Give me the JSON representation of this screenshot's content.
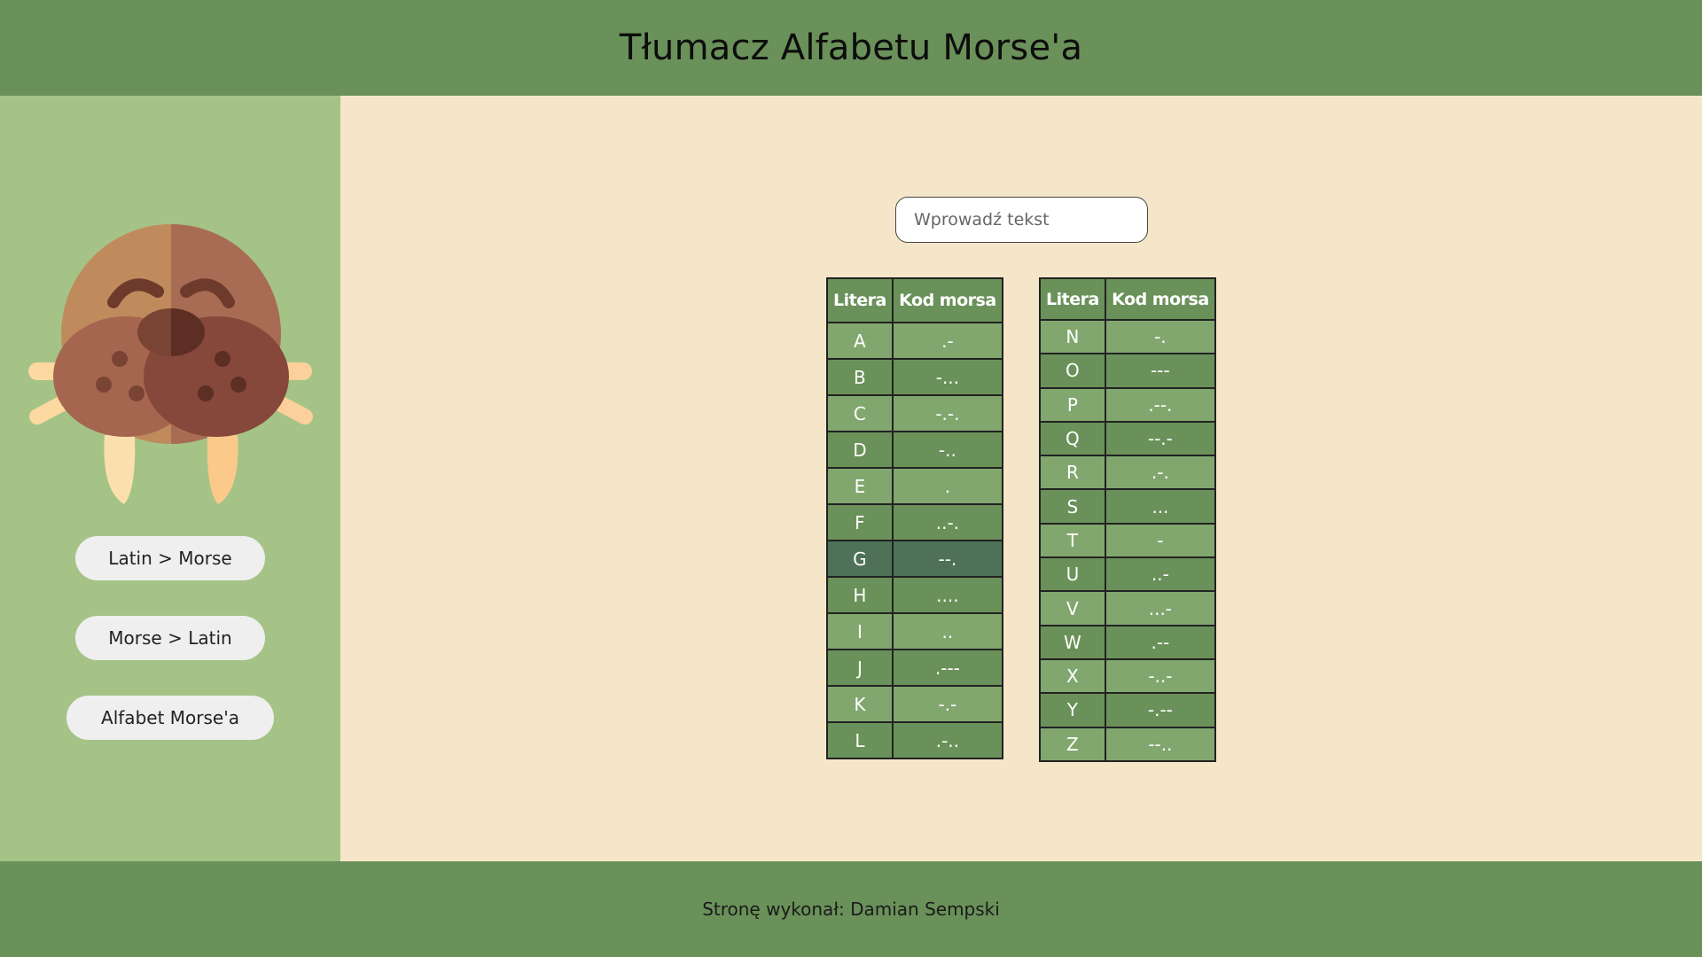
{
  "header": {
    "title": "Tłumacz Alfabetu Morse'a"
  },
  "sidebar": {
    "logo_icon": "walrus-icon",
    "buttons": [
      {
        "label": "Latin > Morse"
      },
      {
        "label": "Morse > Latin"
      },
      {
        "label": "Alfabet Morse'a"
      }
    ]
  },
  "main": {
    "search": {
      "placeholder": "Wprowadź tekst",
      "value": ""
    },
    "table_headers": {
      "letter": "Litera",
      "code": "Kod morsa"
    },
    "table_left": [
      {
        "letter": "A",
        "code": ".-"
      },
      {
        "letter": "B",
        "code": "-..."
      },
      {
        "letter": "C",
        "code": "-.-."
      },
      {
        "letter": "D",
        "code": "-.."
      },
      {
        "letter": "E",
        "code": "."
      },
      {
        "letter": "F",
        "code": "..-."
      },
      {
        "letter": "G",
        "code": "--."
      },
      {
        "letter": "H",
        "code": "...."
      },
      {
        "letter": "I",
        "code": ".."
      },
      {
        "letter": "J",
        "code": ".---"
      },
      {
        "letter": "K",
        "code": "-.-"
      },
      {
        "letter": "L",
        "code": ".-.."
      }
    ],
    "table_right": [
      {
        "letter": "N",
        "code": "-."
      },
      {
        "letter": "O",
        "code": "---"
      },
      {
        "letter": "P",
        "code": ".--."
      },
      {
        "letter": "Q",
        "code": "--.-"
      },
      {
        "letter": "R",
        "code": ".-."
      },
      {
        "letter": "S",
        "code": "..."
      },
      {
        "letter": "T",
        "code": "-"
      },
      {
        "letter": "U",
        "code": "..-"
      },
      {
        "letter": "V",
        "code": "...-"
      },
      {
        "letter": "W",
        "code": ".--"
      },
      {
        "letter": "X",
        "code": "-..-"
      },
      {
        "letter": "Y",
        "code": "-.--"
      },
      {
        "letter": "Z",
        "code": "--.."
      }
    ],
    "highlighted_row": "G"
  },
  "footer": {
    "text": "Stronę wykonał: Damian Sempski"
  },
  "colors": {
    "header_green": "#6a9159",
    "sidebar_green": "#a5c387",
    "main_bg": "#f6e6c9",
    "row_light": "#81a76f",
    "row_dark": "#6a9159",
    "row_highlight": "#4e7157"
  }
}
